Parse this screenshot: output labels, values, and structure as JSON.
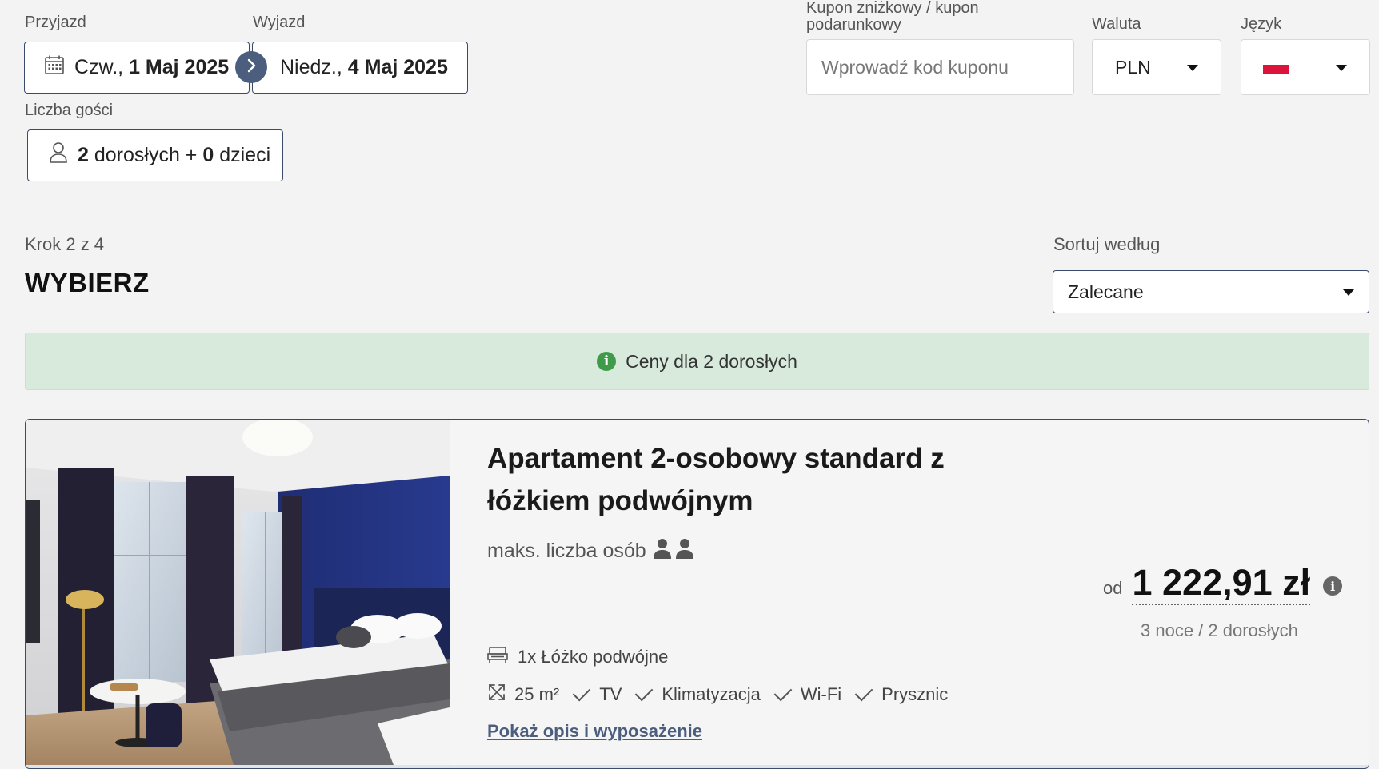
{
  "booking": {
    "arrival_label": "Przyjazd",
    "arrival_day": "Czw.,",
    "arrival_date": "1 Maj 2025",
    "departure_label": "Wyjazd",
    "departure_day": "Niedz.,",
    "departure_date": "4 Maj 2025",
    "guests_label": "Liczba gości",
    "adults_count": "2",
    "adults_text": "dorosłych +",
    "children_count": "0",
    "children_text": "dzieci",
    "coupon_label": "Kupon zniżkowy / kupon podarunkowy",
    "coupon_placeholder": "Wprowadź kod kuponu",
    "currency_label": "Waluta",
    "currency_value": "PLN",
    "language_label": "Język",
    "language_flag_colors": [
      "#ffffff",
      "#dc143c"
    ]
  },
  "step": {
    "counter": "Krok 2 z 4",
    "title": "WYBIERZ"
  },
  "sort": {
    "label": "Sortuj według",
    "value": "Zalecane"
  },
  "info_banner": {
    "text": "Ceny dla 2 dorosłych",
    "color": "#3f9b4a"
  },
  "room": {
    "title": "Apartament 2-osobowy standard z łóżkiem podwójnym",
    "max_persons_label": "maks. liczba osób",
    "max_persons": 2,
    "bed": "1x Łóżko podwójne",
    "features": [
      "25 m²",
      "TV",
      "Klimatyzacja",
      "Wi-Fi",
      "Prysznic"
    ],
    "details_link": "Pokaż opis i wyposażenie",
    "price_prefix": "od",
    "price": "1 222,91 zł",
    "price_note": "3 noce / 2 dorosłych"
  }
}
